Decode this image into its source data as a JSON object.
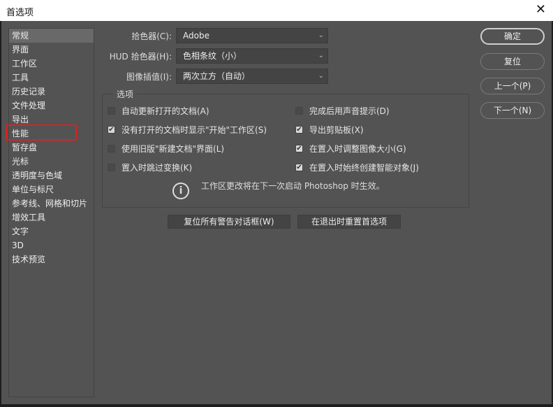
{
  "window": {
    "title": "首选项",
    "close": "✕"
  },
  "sidebar": {
    "items": [
      "常规",
      "界面",
      "工作区",
      "工具",
      "历史记录",
      "文件处理",
      "导出",
      "性能",
      "暂存盘",
      "光标",
      "透明度与色域",
      "单位与标尺",
      "参考线、网格和切片",
      "增效工具",
      "文字",
      "3D",
      "技术预览"
    ],
    "selected": "常规",
    "highlighted": "性能",
    "highlight_color": "#e02020"
  },
  "fields": [
    {
      "label": "拾色器(C):",
      "value": "Adobe"
    },
    {
      "label": "HUD 拾色器(H):",
      "value": "色相条纹（小）"
    },
    {
      "label": "图像插值(I):",
      "value": "两次立方（自动）"
    }
  ],
  "options": {
    "title": "选项",
    "left": [
      {
        "label": "自动更新打开的文档(A)",
        "checked": false
      },
      {
        "label": "没有打开的文档时显示\"开始\"工作区(S)",
        "checked": true
      },
      {
        "label": "使用旧版\"新建文档\"界面(L)",
        "checked": false
      },
      {
        "label": "置入时跳过变换(K)",
        "checked": false
      }
    ],
    "right": [
      {
        "label": "完成后用声音提示(D)",
        "checked": false
      },
      {
        "label": "导出剪贴板(X)",
        "checked": true
      },
      {
        "label": "在置入时调整图像大小(G)",
        "checked": true
      },
      {
        "label": "在置入时始终创建智能对象(J)",
        "checked": true
      }
    ],
    "info": "工作区更改将在下一次启动 Photoshop 时生效。"
  },
  "buttons": {
    "reset_warnings": "复位所有警告对话框(W)",
    "reset_on_quit": "在退出时重置首选项",
    "ok": "确定",
    "reset": "复位",
    "prev": "上一个(P)",
    "next": "下一个(N)"
  }
}
